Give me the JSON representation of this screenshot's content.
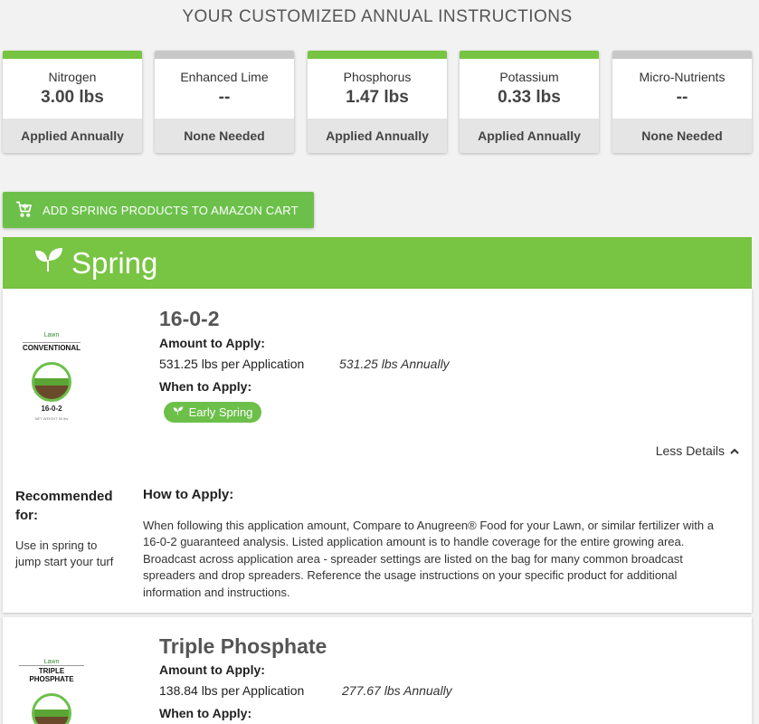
{
  "heading": "YOUR CUSTOMIZED ANNUAL INSTRUCTIONS",
  "nutrients": [
    {
      "name": "Nitrogen",
      "value": "3.00 lbs",
      "status": "Applied Annually",
      "bar": "green"
    },
    {
      "name": "Enhanced Lime",
      "value": "--",
      "status": "None Needed",
      "bar": "grey"
    },
    {
      "name": "Phosphorus",
      "value": "1.47 lbs",
      "status": "Applied Annually",
      "bar": "green"
    },
    {
      "name": "Potassium",
      "value": "0.33 lbs",
      "status": "Applied Annually",
      "bar": "green"
    },
    {
      "name": "Micro-Nutrients",
      "value": "--",
      "status": "None Needed",
      "bar": "grey"
    }
  ],
  "cart_button": {
    "label": "ADD SPRING PRODUCTS TO AMAZON CART",
    "icon": "cart-plus-icon"
  },
  "season": {
    "label": "Spring",
    "icon": "sprout-icon"
  },
  "colors": {
    "accent_green": "#78c443",
    "bar_grey": "#c8c8c8"
  },
  "products": [
    {
      "title": "16-0-2",
      "bag": {
        "brand": "Lawn",
        "type": "CONVENTIONAL",
        "code": "16-0-2",
        "net": "NET WEIGHT 50 lbs"
      },
      "amount_label": "Amount to Apply:",
      "per_application": "531.25 lbs per Application",
      "annually": "531.25 lbs Annually",
      "when_label": "When to Apply:",
      "when_badge": "Early Spring",
      "less_details": "Less Details",
      "recommended_title": "Recommended for:",
      "recommended_text": "Use in spring to jump start your turf",
      "how_title": "How to Apply:",
      "how_text": "When following this application amount, Compare to Anugreen® Food for your Lawn, or similar fertilizer with a 16-0-2 guaranteed analysis. Listed application amount is to handle coverage for the entire growing area. Broadcast across application area - spreader settings are listed on the bag for many common broadcast spreaders and drop spreaders. Reference the usage instructions on your specific product for additional information and instructions."
    },
    {
      "title": "Triple Phosphate",
      "bag": {
        "brand": "Lawn",
        "type": "TRIPLE PHOSPHATE"
      },
      "amount_label": "Amount to Apply:",
      "per_application": "138.84 lbs per Application",
      "annually": "277.67 lbs Annually",
      "when_label": "When to Apply:"
    }
  ]
}
